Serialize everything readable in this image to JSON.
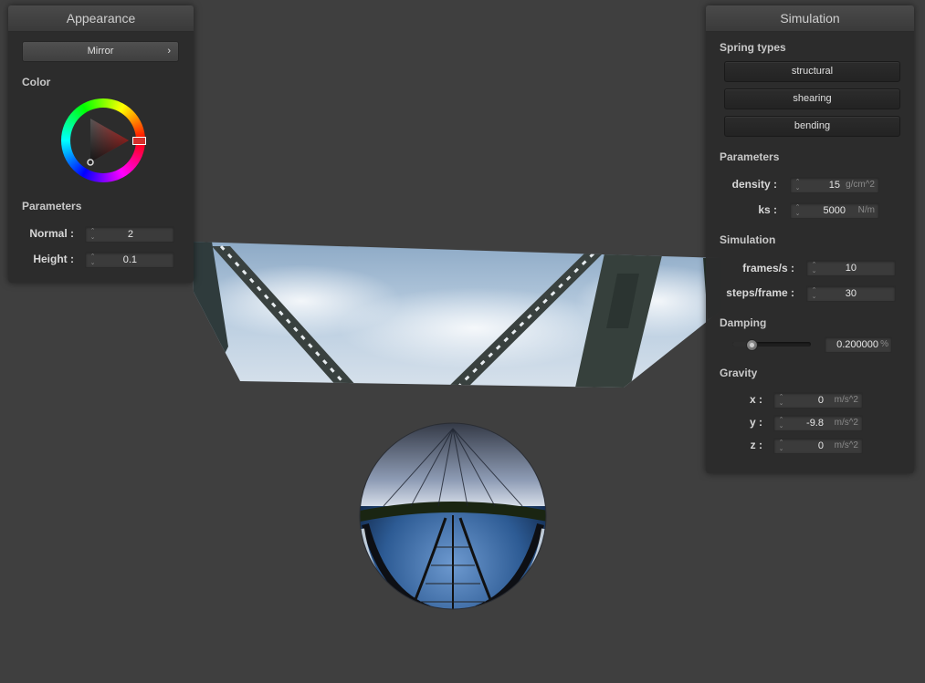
{
  "appearance_panel": {
    "title": "Appearance",
    "shader_selector": "Mirror",
    "color_section": "Color",
    "color_wheel_hex": "#d4302c",
    "parameters_section": "Parameters",
    "normal_label": "Normal :",
    "normal_value": "2",
    "height_label": "Height :",
    "height_value": "0.1"
  },
  "simulation_panel": {
    "title": "Simulation",
    "spring_types_section": "Spring types",
    "spring_buttons": [
      "structural",
      "shearing",
      "bending"
    ],
    "parameters_section": "Parameters",
    "density_label": "density :",
    "density_value": "15",
    "density_unit": "g/cm^2",
    "ks_label": "ks :",
    "ks_value": "5000",
    "ks_unit": "N/m",
    "simulation_section": "Simulation",
    "fps_label": "frames/s :",
    "fps_value": "10",
    "steps_label": "steps/frame :",
    "steps_value": "30",
    "damping_section": "Damping",
    "damping_fraction": 0.2,
    "damping_value": "0.200000",
    "damping_unit": "%",
    "gravity_section": "Gravity",
    "gx_label": "x :",
    "gx_value": "0",
    "gy_label": "y :",
    "gy_value": "-9.8",
    "gz_label": "z :",
    "gz_value": "0",
    "gravity_unit": "m/s^2"
  },
  "colors": {
    "background": "#3f3f3f",
    "panel": "#2c2c2c",
    "accent_red": "#d4302c"
  }
}
